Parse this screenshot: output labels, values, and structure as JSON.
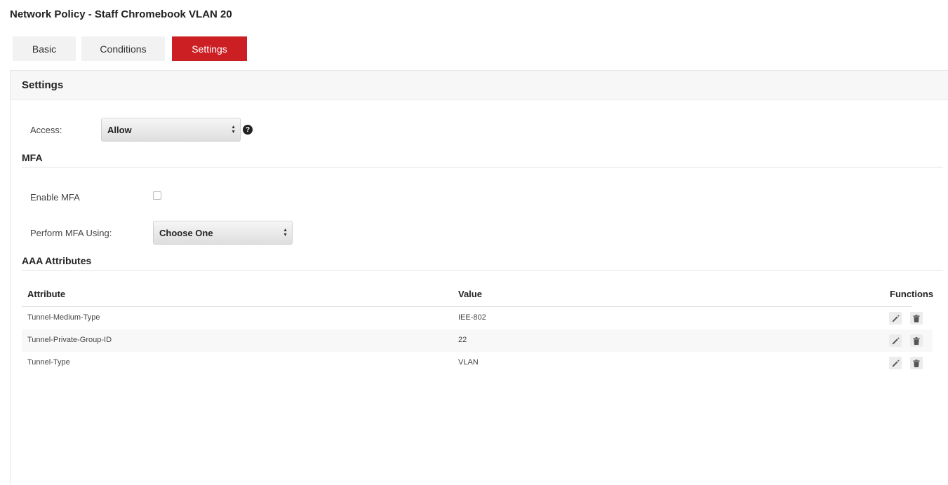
{
  "page": {
    "title": "Network Policy - Staff Chromebook VLAN 20"
  },
  "tabs": [
    {
      "label": "Basic",
      "active": false
    },
    {
      "label": "Conditions",
      "active": false
    },
    {
      "label": "Settings",
      "active": true
    }
  ],
  "colors": {
    "accent": "#cc1f24",
    "tab_bg": "#f2f2f2"
  },
  "settings": {
    "title": "Settings",
    "access": {
      "label": "Access:",
      "value": "Allow",
      "help_icon": "question-circle-icon"
    }
  },
  "mfa": {
    "title": "MFA",
    "enable": {
      "label": "Enable MFA",
      "checked": false
    },
    "method": {
      "label": "Perform MFA Using:",
      "value": "Choose One"
    }
  },
  "aaa": {
    "title": "AAA Attributes",
    "columns": {
      "attribute": "Attribute",
      "value": "Value",
      "functions": "Functions"
    },
    "rows": [
      {
        "attribute": "Tunnel-Medium-Type",
        "value": "IEE-802"
      },
      {
        "attribute": "Tunnel-Private-Group-ID",
        "value": "22"
      },
      {
        "attribute": "Tunnel-Type",
        "value": "VLAN"
      }
    ],
    "icons": {
      "edit": "pencil-icon",
      "delete": "trash-icon"
    }
  }
}
